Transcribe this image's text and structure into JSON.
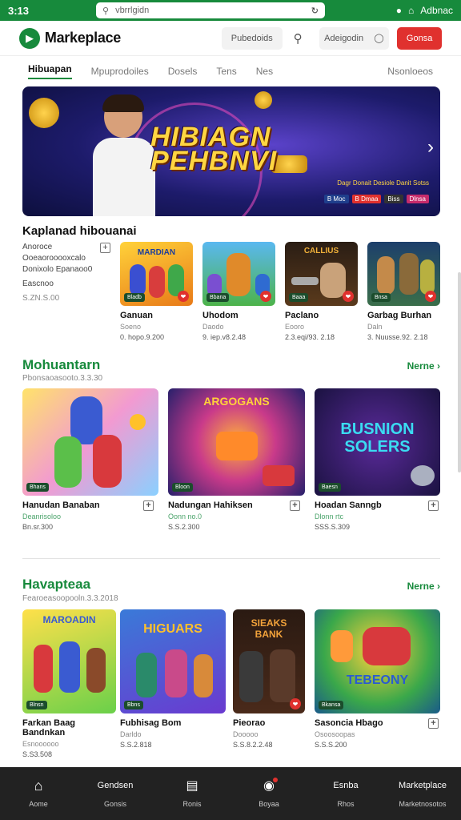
{
  "status": {
    "time": "3:13",
    "url": "vbrrlgidn",
    "right_text": "Adbnac"
  },
  "header": {
    "logo": "Markeplace",
    "button1": "Pubedoids",
    "button2": "Adeigodin",
    "button3": "Gonsa"
  },
  "tabs": [
    "Hibuapan",
    "Mpuprodoiles",
    "Dosels",
    "Tens",
    "Nes"
  ],
  "tabs_right": "Nsonloeos",
  "hero": {
    "title_line1": "HIBIAGN",
    "title_line2": "PEHBNVI",
    "promo": "Dagr Donait Desiole Danit Sotss",
    "tags": [
      "B Moc",
      "B Dmaa",
      "Biss",
      "Dlnsa"
    ]
  },
  "section1": {
    "title": "Kaplanad hibouanai",
    "side": {
      "title": "Anoroce",
      "line1": "Ooeaorooooxcalo",
      "line2": "Donixolo Epanaoo0",
      "line3": "Eascnoo",
      "price": "S.ZN.S.00"
    },
    "items": [
      {
        "name": "Ganuan",
        "meta": "Soeno",
        "price": "0. hopo.9.200",
        "tag": "Bladb",
        "thumb": "MARDIAN"
      },
      {
        "name": "Uhodom",
        "meta": "Daodo",
        "price": "9. iep.v8.2.48",
        "tag": "Bbana",
        "thumb": ""
      },
      {
        "name": "Paclano",
        "meta": "Eooro",
        "price": "2.3.eqi/93. 2.18",
        "tag": "Baaa",
        "thumb": "CALLIUS"
      },
      {
        "name": "Garbag Burhan",
        "meta": "Daln",
        "price": "3. Nuusse.92. 2.18",
        "tag": "Bnsa",
        "thumb": ""
      }
    ]
  },
  "section2": {
    "title": "Mohuantarn",
    "more": "Nerne",
    "sub": "Pbonsaoasooto.3.3.30",
    "items": [
      {
        "name": "Hanudan Banaban",
        "meta": "Deanrisoloo",
        "price": "Bn.sr.300",
        "tag": "Bhans",
        "thumb": ""
      },
      {
        "name": "Nadungan Hahiksen",
        "meta": "Oonn no.0",
        "price": "S.S.2.300",
        "tag": "Bloon",
        "thumb": "ARGOGANS"
      },
      {
        "name": "Hoadan Sanngb",
        "meta": "Dlonn rtc",
        "price": "SSS.S.309",
        "tag": "Baesn",
        "thumb": "BUSNION SOLERS"
      }
    ]
  },
  "section3": {
    "title": "Havapteaa",
    "more": "Nerne",
    "sub": "Fearoeasoopooln.3.3.2018",
    "items": [
      {
        "name": "Farkan Baag Bandnkan",
        "meta": "Esnoooooo",
        "price": "S.S3.508",
        "tag": "Blnsn",
        "thumb": "MAROADIN"
      },
      {
        "name": "Fubhisag Bom",
        "meta": "Darldo",
        "price": "S.S.2.818",
        "tag": "Bbns",
        "thumb": "HIGUARS"
      },
      {
        "name": "Pieorao",
        "meta": "Dooooo",
        "price": "S.S.8.2.2.48",
        "tag": "Bhsa",
        "thumb": "SIEAKS BANK"
      },
      {
        "name": "Sasoncia Hbago",
        "meta": "Osoosoopas",
        "price": "S.S.S.200",
        "tag": "Bkansa",
        "thumb": "TEBEONY"
      }
    ]
  },
  "bottom_nav": [
    {
      "top": "",
      "label": "Aome",
      "icon": "home-icon"
    },
    {
      "top": "Gendsen",
      "label": "Gonsis",
      "icon": ""
    },
    {
      "top": "",
      "label": "Ronis",
      "icon": "chat-icon"
    },
    {
      "top": "",
      "label": "Boyaa",
      "icon": "camera-icon"
    },
    {
      "top": "Esnba",
      "label": "Rhos",
      "icon": ""
    },
    {
      "top": "Marketplace",
      "label": "Marketnosotos",
      "icon": ""
    }
  ],
  "colors": {
    "accent": "#178a3c",
    "danger": "#e0312e",
    "nav_bg": "#222222"
  }
}
